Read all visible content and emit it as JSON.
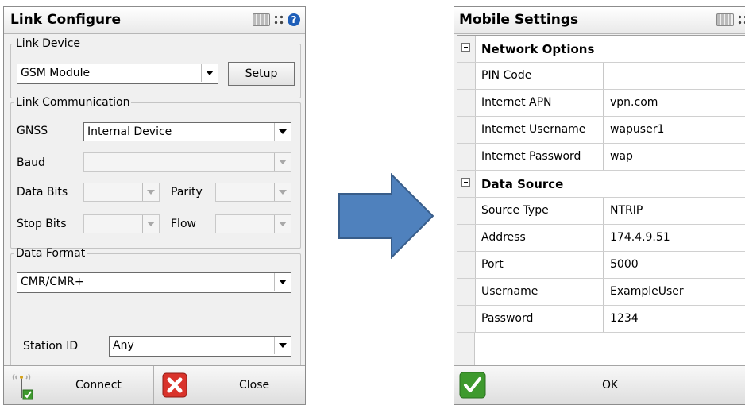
{
  "link_configure": {
    "title": "Link Configure",
    "link_device": {
      "legend": "Link Device",
      "device_value": "GSM Module",
      "setup_label": "Setup"
    },
    "link_communication": {
      "legend": "Link Communication",
      "gnss_label": "GNSS",
      "gnss_value": "Internal Device",
      "baud_label": "Baud",
      "data_bits_label": "Data Bits",
      "parity_label": "Parity",
      "stop_bits_label": "Stop Bits",
      "flow_label": "Flow"
    },
    "data_format": {
      "legend": "Data Format",
      "format_value": "CMR/CMR+",
      "station_id_label": "Station ID",
      "station_id_value": "Any"
    },
    "bottom": {
      "connect_label": "Connect",
      "close_label": "Close"
    }
  },
  "mobile_settings": {
    "title": "Mobile Settings",
    "categories": [
      {
        "name": "Network Options",
        "rows": [
          {
            "name": "PIN Code",
            "value": ""
          },
          {
            "name": "Internet APN",
            "value": "vpn.com"
          },
          {
            "name": "Internet Username",
            "value": "wapuser1"
          },
          {
            "name": "Internet Password",
            "value": "wap"
          }
        ]
      },
      {
        "name": "Data Source",
        "rows": [
          {
            "name": "Source Type",
            "value": "NTRIP"
          },
          {
            "name": "Address",
            "value": "174.4.9.51"
          },
          {
            "name": "Port",
            "value": "5000"
          },
          {
            "name": "Username",
            "value": "ExampleUser"
          },
          {
            "name": "Password",
            "value": "1234"
          }
        ]
      }
    ],
    "ok_label": "OK"
  },
  "colors": {
    "arrow_fill": "#4f81bd",
    "arrow_stroke": "#385d8a",
    "close_red": "#d9332b",
    "check_green": "#3e9a2e"
  }
}
